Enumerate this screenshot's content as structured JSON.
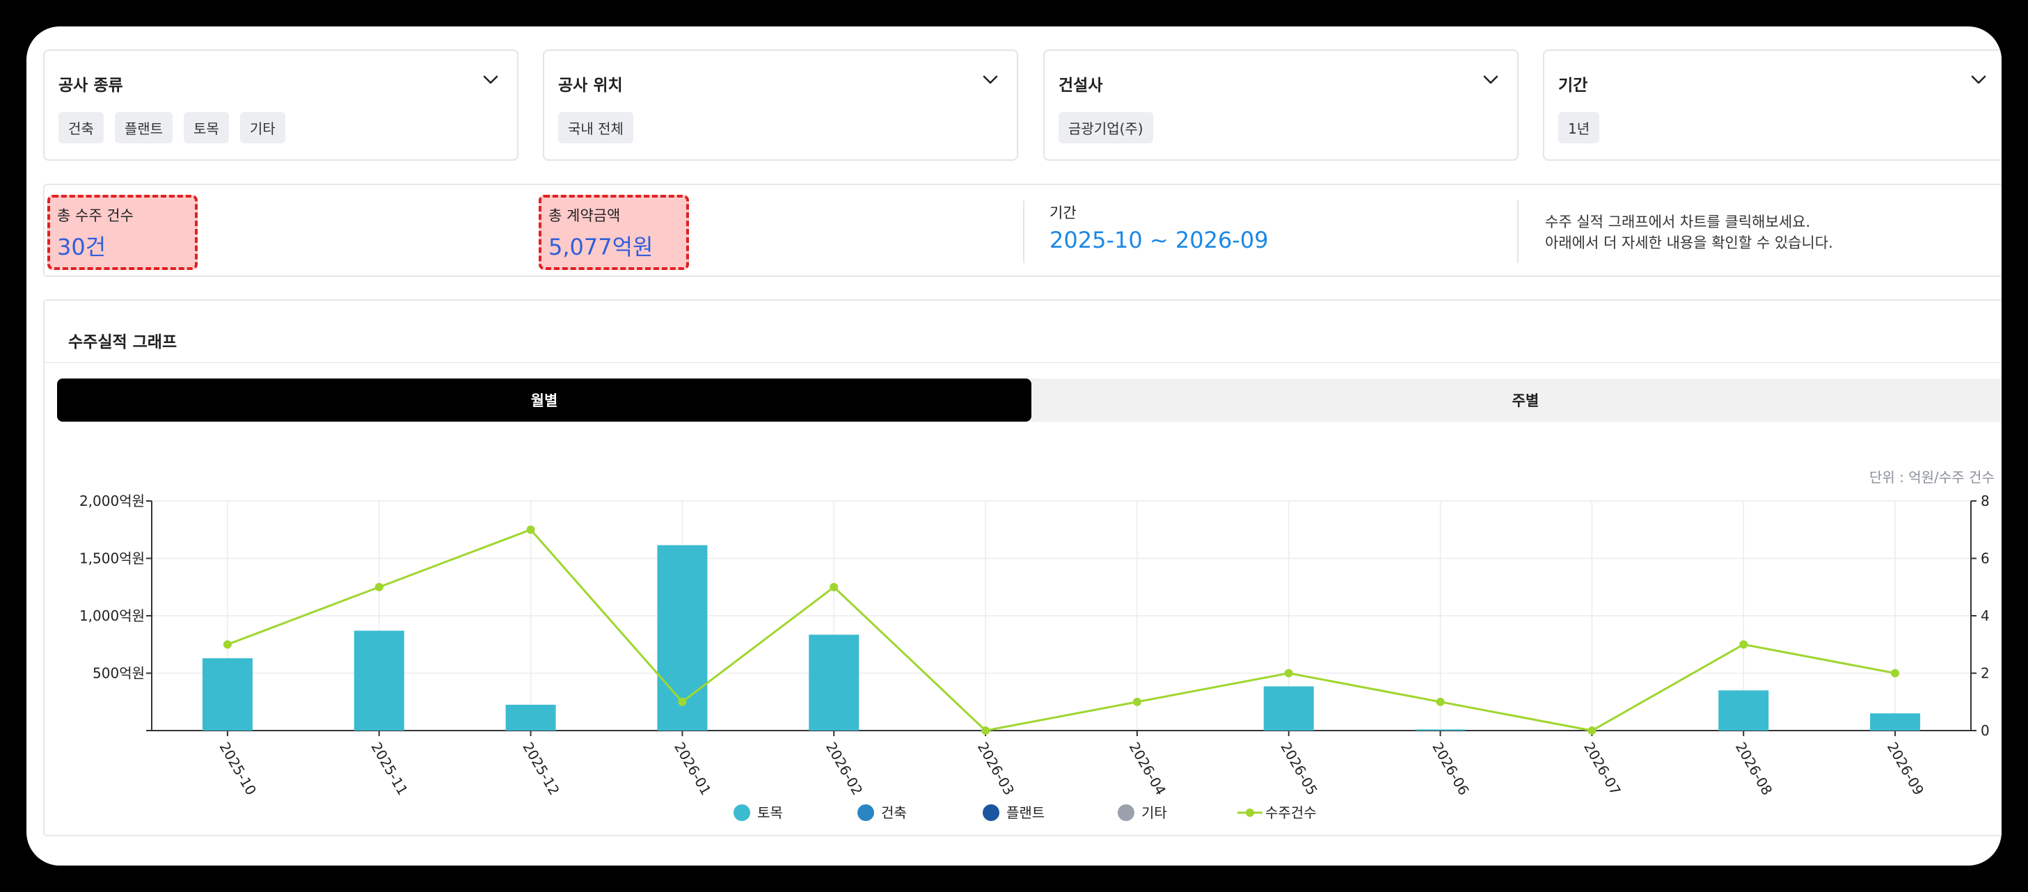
{
  "filters": [
    {
      "title": "공사 종류",
      "chips": [
        "건축",
        "플랜트",
        "토목",
        "기타"
      ]
    },
    {
      "title": "공사 위치",
      "chips": [
        "국내 전체"
      ]
    },
    {
      "title": "건설사",
      "chips": [
        "금광기업(주)"
      ]
    },
    {
      "title": "기간",
      "chips": [
        "1년"
      ]
    }
  ],
  "summary": {
    "total_count_label": "총 수주 건수",
    "total_count_value": "30건",
    "total_amount_label": "총 계약금액",
    "total_amount_value": "5,077억원",
    "period_label": "기간",
    "period_value": "2025-10 ~ 2026-09",
    "info_line1": "수주 실적 그래프에서 차트를 클릭해보세요.",
    "info_line2": "아래에서 더 자세한 내용을 확인할 수 있습니다."
  },
  "chart_section": {
    "title": "수주실적 그래프",
    "tab_monthly": "월별",
    "tab_weekly": "주별",
    "unit": "단위 : 억원/수주 건수"
  },
  "chart_data": {
    "type": "bar",
    "categories": [
      "2025-10",
      "2025-11",
      "2025-12",
      "2026-01",
      "2026-02",
      "2026-03",
      "2026-04",
      "2026-05",
      "2026-06",
      "2026-07",
      "2026-08",
      "2026-09"
    ],
    "series": [
      {
        "name": "토목",
        "type": "bar",
        "color": "#3bbbd0",
        "values": [
          630,
          870,
          225,
          1615,
          835,
          0,
          0,
          385,
          10,
          0,
          350,
          150
        ]
      },
      {
        "name": "건축",
        "type": "bar",
        "color": "#2a86c3",
        "values": [
          0,
          0,
          0,
          0,
          0,
          0,
          0,
          0,
          0,
          0,
          0,
          0
        ]
      },
      {
        "name": "플랜트",
        "type": "bar",
        "color": "#1a56a0",
        "values": [
          0,
          0,
          0,
          0,
          0,
          0,
          0,
          0,
          0,
          0,
          0,
          0
        ]
      },
      {
        "name": "기타",
        "type": "bar",
        "color": "#9aa1ad",
        "values": [
          0,
          0,
          0,
          0,
          0,
          0,
          0,
          0,
          0,
          0,
          0,
          0
        ]
      },
      {
        "name": "수주건수",
        "type": "line",
        "axis": "right",
        "color": "#9fd62f",
        "values": [
          3,
          5,
          7,
          1,
          5,
          0,
          1,
          2,
          1,
          0,
          3,
          2
        ]
      }
    ],
    "y_left": {
      "ylim": [
        0,
        2000
      ],
      "ticks": [
        0,
        500,
        1000,
        1500,
        2000
      ],
      "tick_labels": [
        "",
        "500억원",
        "1,000억원",
        "1,500억원",
        "2,000억원"
      ]
    },
    "y_right": {
      "ylim": [
        0,
        8
      ],
      "ticks": [
        0,
        2,
        4,
        6,
        8
      ],
      "tick_labels": [
        "0",
        "2",
        "4",
        "6",
        "8"
      ]
    },
    "grid": true,
    "legend_position": "bottom"
  }
}
